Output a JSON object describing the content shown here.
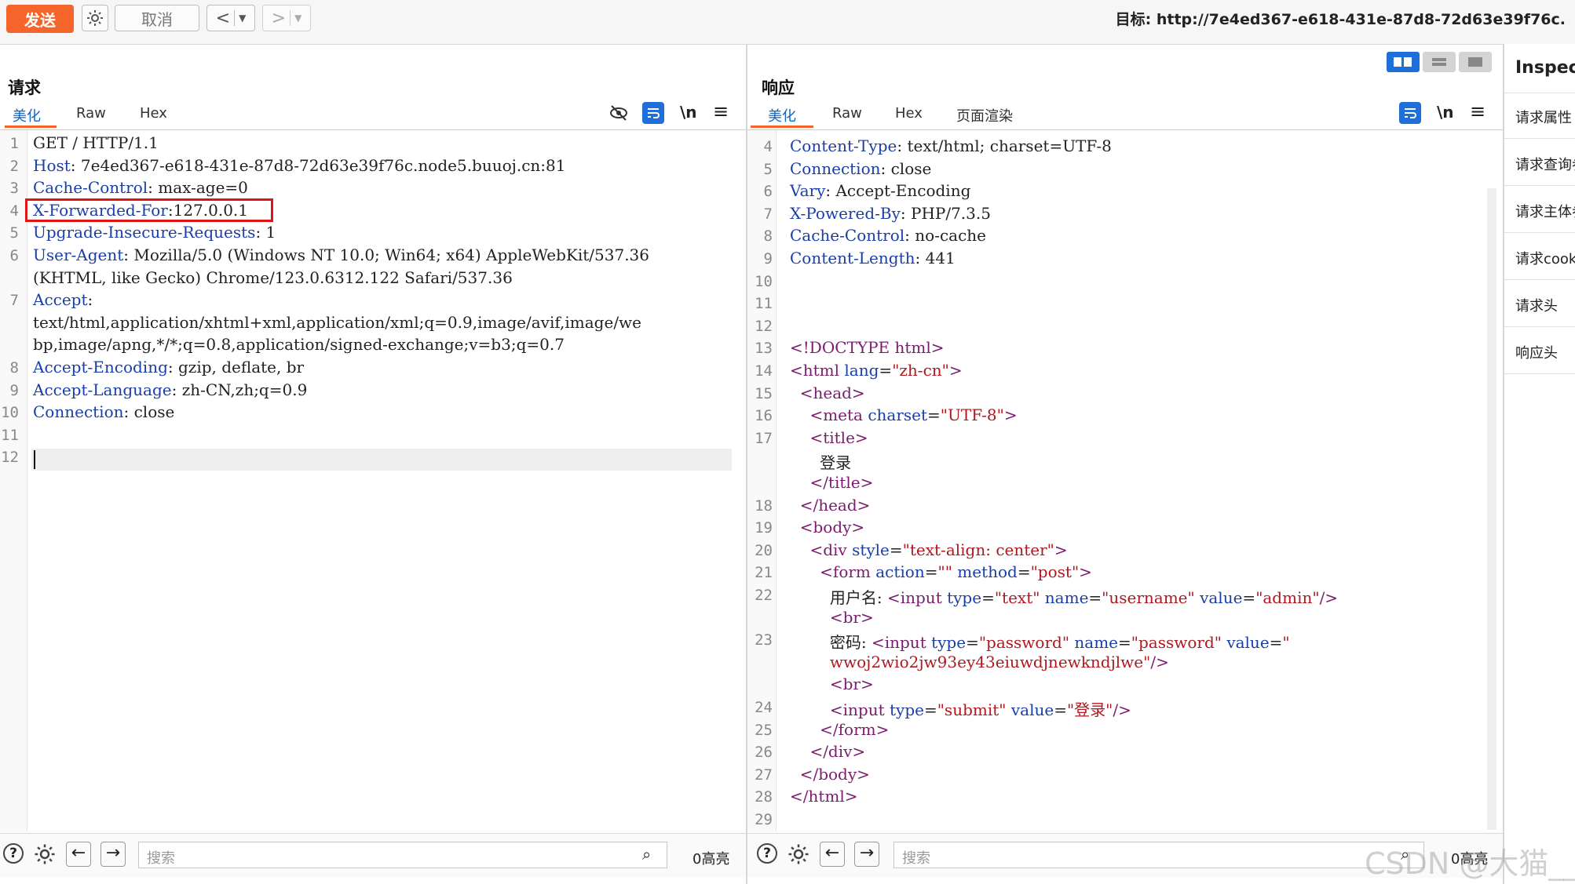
{
  "toolbar": {
    "send_label": "发送",
    "cancel_label": "取消",
    "target_label": "目标: http://7e4ed367-e618-431e-87d8-72d63e39f76c."
  },
  "request": {
    "title": "请求",
    "tabs": [
      "美化",
      "Raw",
      "Hex"
    ],
    "lines": [
      {
        "n": "1",
        "parts": [
          [
            "GET / HTTP/1.1",
            ""
          ]
        ]
      },
      {
        "n": "2",
        "parts": [
          [
            "Host",
            "hk"
          ],
          [
            ": 7e4ed367-e618-431e-87d8-72d63e39f76c.node5.buuoj.cn:81",
            ""
          ]
        ]
      },
      {
        "n": "3",
        "parts": [
          [
            "Cache-Control",
            "hk"
          ],
          [
            ": max-age=0",
            ""
          ]
        ]
      },
      {
        "n": "4",
        "parts": [
          [
            "X-Forwarded-For",
            "hk"
          ],
          [
            ":127.0.0.1",
            ""
          ]
        ]
      },
      {
        "n": "5",
        "parts": [
          [
            "Upgrade-Insecure-Requests",
            "hk"
          ],
          [
            ": 1",
            ""
          ]
        ]
      },
      {
        "n": "6",
        "parts": [
          [
            "User-Agent",
            "hk"
          ],
          [
            ": Mozilla/5.0 (Windows NT 10.0; Win64; x64) AppleWebKit/537.36",
            ""
          ]
        ]
      },
      {
        "n": "",
        "parts": [
          [
            "(KHTML, like Gecko) Chrome/123.0.6312.122 Safari/537.36",
            ""
          ]
        ]
      },
      {
        "n": "7",
        "parts": [
          [
            "Accept",
            "hk"
          ],
          [
            ":",
            ""
          ]
        ]
      },
      {
        "n": "",
        "parts": [
          [
            "text/html,application/xhtml+xml,application/xml;q=0.9,image/avif,image/we",
            ""
          ]
        ]
      },
      {
        "n": "",
        "parts": [
          [
            "bp,image/apng,*/*;q=0.8,application/signed-exchange;v=b3;q=0.7",
            ""
          ]
        ]
      },
      {
        "n": "8",
        "parts": [
          [
            "Accept-Encoding",
            "hk"
          ],
          [
            ": gzip, deflate, br",
            ""
          ]
        ]
      },
      {
        "n": "9",
        "parts": [
          [
            "Accept-Language",
            "hk"
          ],
          [
            ": zh-CN,zh;q=0.9",
            ""
          ]
        ]
      },
      {
        "n": "10",
        "parts": [
          [
            "Connection",
            "hk"
          ],
          [
            ": close",
            ""
          ]
        ]
      },
      {
        "n": "11",
        "parts": []
      },
      {
        "n": "12",
        "parts": []
      }
    ],
    "search_placeholder": "搜索",
    "highlight_count": "0高亮"
  },
  "response": {
    "title": "响应",
    "tabs": [
      "美化",
      "Raw",
      "Hex",
      "页面渲染"
    ],
    "lines": [
      {
        "n": "4",
        "parts": [
          [
            "Content-Type",
            "hk"
          ],
          [
            ": text/html; charset=UTF-8",
            ""
          ]
        ]
      },
      {
        "n": "5",
        "parts": [
          [
            "Connection",
            "hk"
          ],
          [
            ": close",
            ""
          ]
        ]
      },
      {
        "n": "6",
        "parts": [
          [
            "Vary",
            "hk"
          ],
          [
            ": Accept-Encoding",
            ""
          ]
        ]
      },
      {
        "n": "7",
        "parts": [
          [
            "X-Powered-By",
            "hk"
          ],
          [
            ": PHP/7.3.5",
            ""
          ]
        ]
      },
      {
        "n": "8",
        "parts": [
          [
            "Cache-Control",
            "hk"
          ],
          [
            ": no-cache",
            ""
          ]
        ]
      },
      {
        "n": "9",
        "parts": [
          [
            "Content-Length",
            "hk"
          ],
          [
            ": 441",
            ""
          ]
        ]
      },
      {
        "n": "10",
        "parts": []
      },
      {
        "n": "11",
        "parts": []
      },
      {
        "n": "12",
        "parts": []
      },
      {
        "n": "13",
        "parts": [
          [
            "<!DOCTYPE html>",
            "tg"
          ]
        ]
      },
      {
        "n": "14",
        "parts": [
          [
            "<html ",
            "tg"
          ],
          [
            "lang",
            "at"
          ],
          [
            "=",
            ""
          ],
          [
            "\"zh-cn\"",
            "sv"
          ],
          [
            ">",
            "tg"
          ]
        ]
      },
      {
        "n": "15",
        "parts": [
          [
            "  ",
            ""
          ],
          [
            "<head>",
            "tg"
          ]
        ]
      },
      {
        "n": "16",
        "parts": [
          [
            "    ",
            ""
          ],
          [
            "<meta ",
            "tg"
          ],
          [
            "charset",
            "at"
          ],
          [
            "=",
            ""
          ],
          [
            "\"UTF-8\"",
            "sv"
          ],
          [
            ">",
            "tg"
          ]
        ]
      },
      {
        "n": "17",
        "parts": [
          [
            "    ",
            ""
          ],
          [
            "<title>",
            "tg"
          ]
        ]
      },
      {
        "n": "",
        "parts": [
          [
            "      登录",
            ""
          ]
        ]
      },
      {
        "n": "",
        "parts": [
          [
            "    ",
            ""
          ],
          [
            "</title>",
            "tg"
          ]
        ]
      },
      {
        "n": "18",
        "parts": [
          [
            "  ",
            ""
          ],
          [
            "</head>",
            "tg"
          ]
        ]
      },
      {
        "n": "19",
        "parts": [
          [
            "  ",
            ""
          ],
          [
            "<body>",
            "tg"
          ]
        ]
      },
      {
        "n": "20",
        "parts": [
          [
            "    ",
            ""
          ],
          [
            "<div ",
            "tg"
          ],
          [
            "style",
            "at"
          ],
          [
            "=",
            ""
          ],
          [
            "\"text-align: center\"",
            "sv"
          ],
          [
            ">",
            "tg"
          ]
        ]
      },
      {
        "n": "21",
        "parts": [
          [
            "      ",
            ""
          ],
          [
            "<form ",
            "tg"
          ],
          [
            "action",
            "at"
          ],
          [
            "=",
            ""
          ],
          [
            "\"\" ",
            "sv"
          ],
          [
            "method",
            "at"
          ],
          [
            "=",
            ""
          ],
          [
            "\"post\"",
            "sv"
          ],
          [
            ">",
            "tg"
          ]
        ]
      },
      {
        "n": "22",
        "parts": [
          [
            "        用户名: ",
            ""
          ],
          [
            "<input ",
            "tg"
          ],
          [
            "type",
            "at"
          ],
          [
            "=",
            ""
          ],
          [
            "\"text\" ",
            "sv"
          ],
          [
            "name",
            "at"
          ],
          [
            "=",
            ""
          ],
          [
            "\"username\" ",
            "sv"
          ],
          [
            "value",
            "at"
          ],
          [
            "=",
            ""
          ],
          [
            "\"admin\"",
            "sv"
          ],
          [
            "/>",
            "tg"
          ]
        ]
      },
      {
        "n": "",
        "parts": [
          [
            "        ",
            ""
          ],
          [
            "<br>",
            "tg"
          ]
        ]
      },
      {
        "n": "23",
        "parts": [
          [
            "        密码: ",
            ""
          ],
          [
            "<input ",
            "tg"
          ],
          [
            "type",
            "at"
          ],
          [
            "=",
            ""
          ],
          [
            "\"password\" ",
            "sv"
          ],
          [
            "name",
            "at"
          ],
          [
            "=",
            ""
          ],
          [
            "\"password\" ",
            "sv"
          ],
          [
            "value",
            "at"
          ],
          [
            "=",
            ""
          ],
          [
            "\"",
            "sv"
          ]
        ]
      },
      {
        "n": "",
        "parts": [
          [
            "        ",
            ""
          ],
          [
            "wwoj2wio2jw93ey43eiuwdjnewkndjlwe\"",
            "sv"
          ],
          [
            "/>",
            "tg"
          ]
        ]
      },
      {
        "n": "",
        "parts": [
          [
            "        ",
            ""
          ],
          [
            "<br>",
            "tg"
          ]
        ]
      },
      {
        "n": "24",
        "parts": [
          [
            "        ",
            ""
          ],
          [
            "<input ",
            "tg"
          ],
          [
            "type",
            "at"
          ],
          [
            "=",
            ""
          ],
          [
            "\"submit\" ",
            "sv"
          ],
          [
            "value",
            "at"
          ],
          [
            "=",
            ""
          ],
          [
            "\"登录\"",
            "sv"
          ],
          [
            "/>",
            "tg"
          ]
        ]
      },
      {
        "n": "25",
        "parts": [
          [
            "      ",
            ""
          ],
          [
            "</form>",
            "tg"
          ]
        ]
      },
      {
        "n": "26",
        "parts": [
          [
            "    ",
            ""
          ],
          [
            "</div>",
            "tg"
          ]
        ]
      },
      {
        "n": "27",
        "parts": [
          [
            "  ",
            ""
          ],
          [
            "</body>",
            "tg"
          ]
        ]
      },
      {
        "n": "28",
        "parts": [
          [
            "</html>",
            "tg"
          ]
        ]
      },
      {
        "n": "29",
        "parts": []
      }
    ],
    "search_placeholder": "搜索",
    "highlight_count": "0高亮"
  },
  "inspector": {
    "title": "Inspect",
    "items": [
      "请求属性",
      "请求查询参",
      "请求主体参",
      "请求cook",
      "请求头",
      "响应头"
    ]
  },
  "watermark": "CSDN @大猫__"
}
